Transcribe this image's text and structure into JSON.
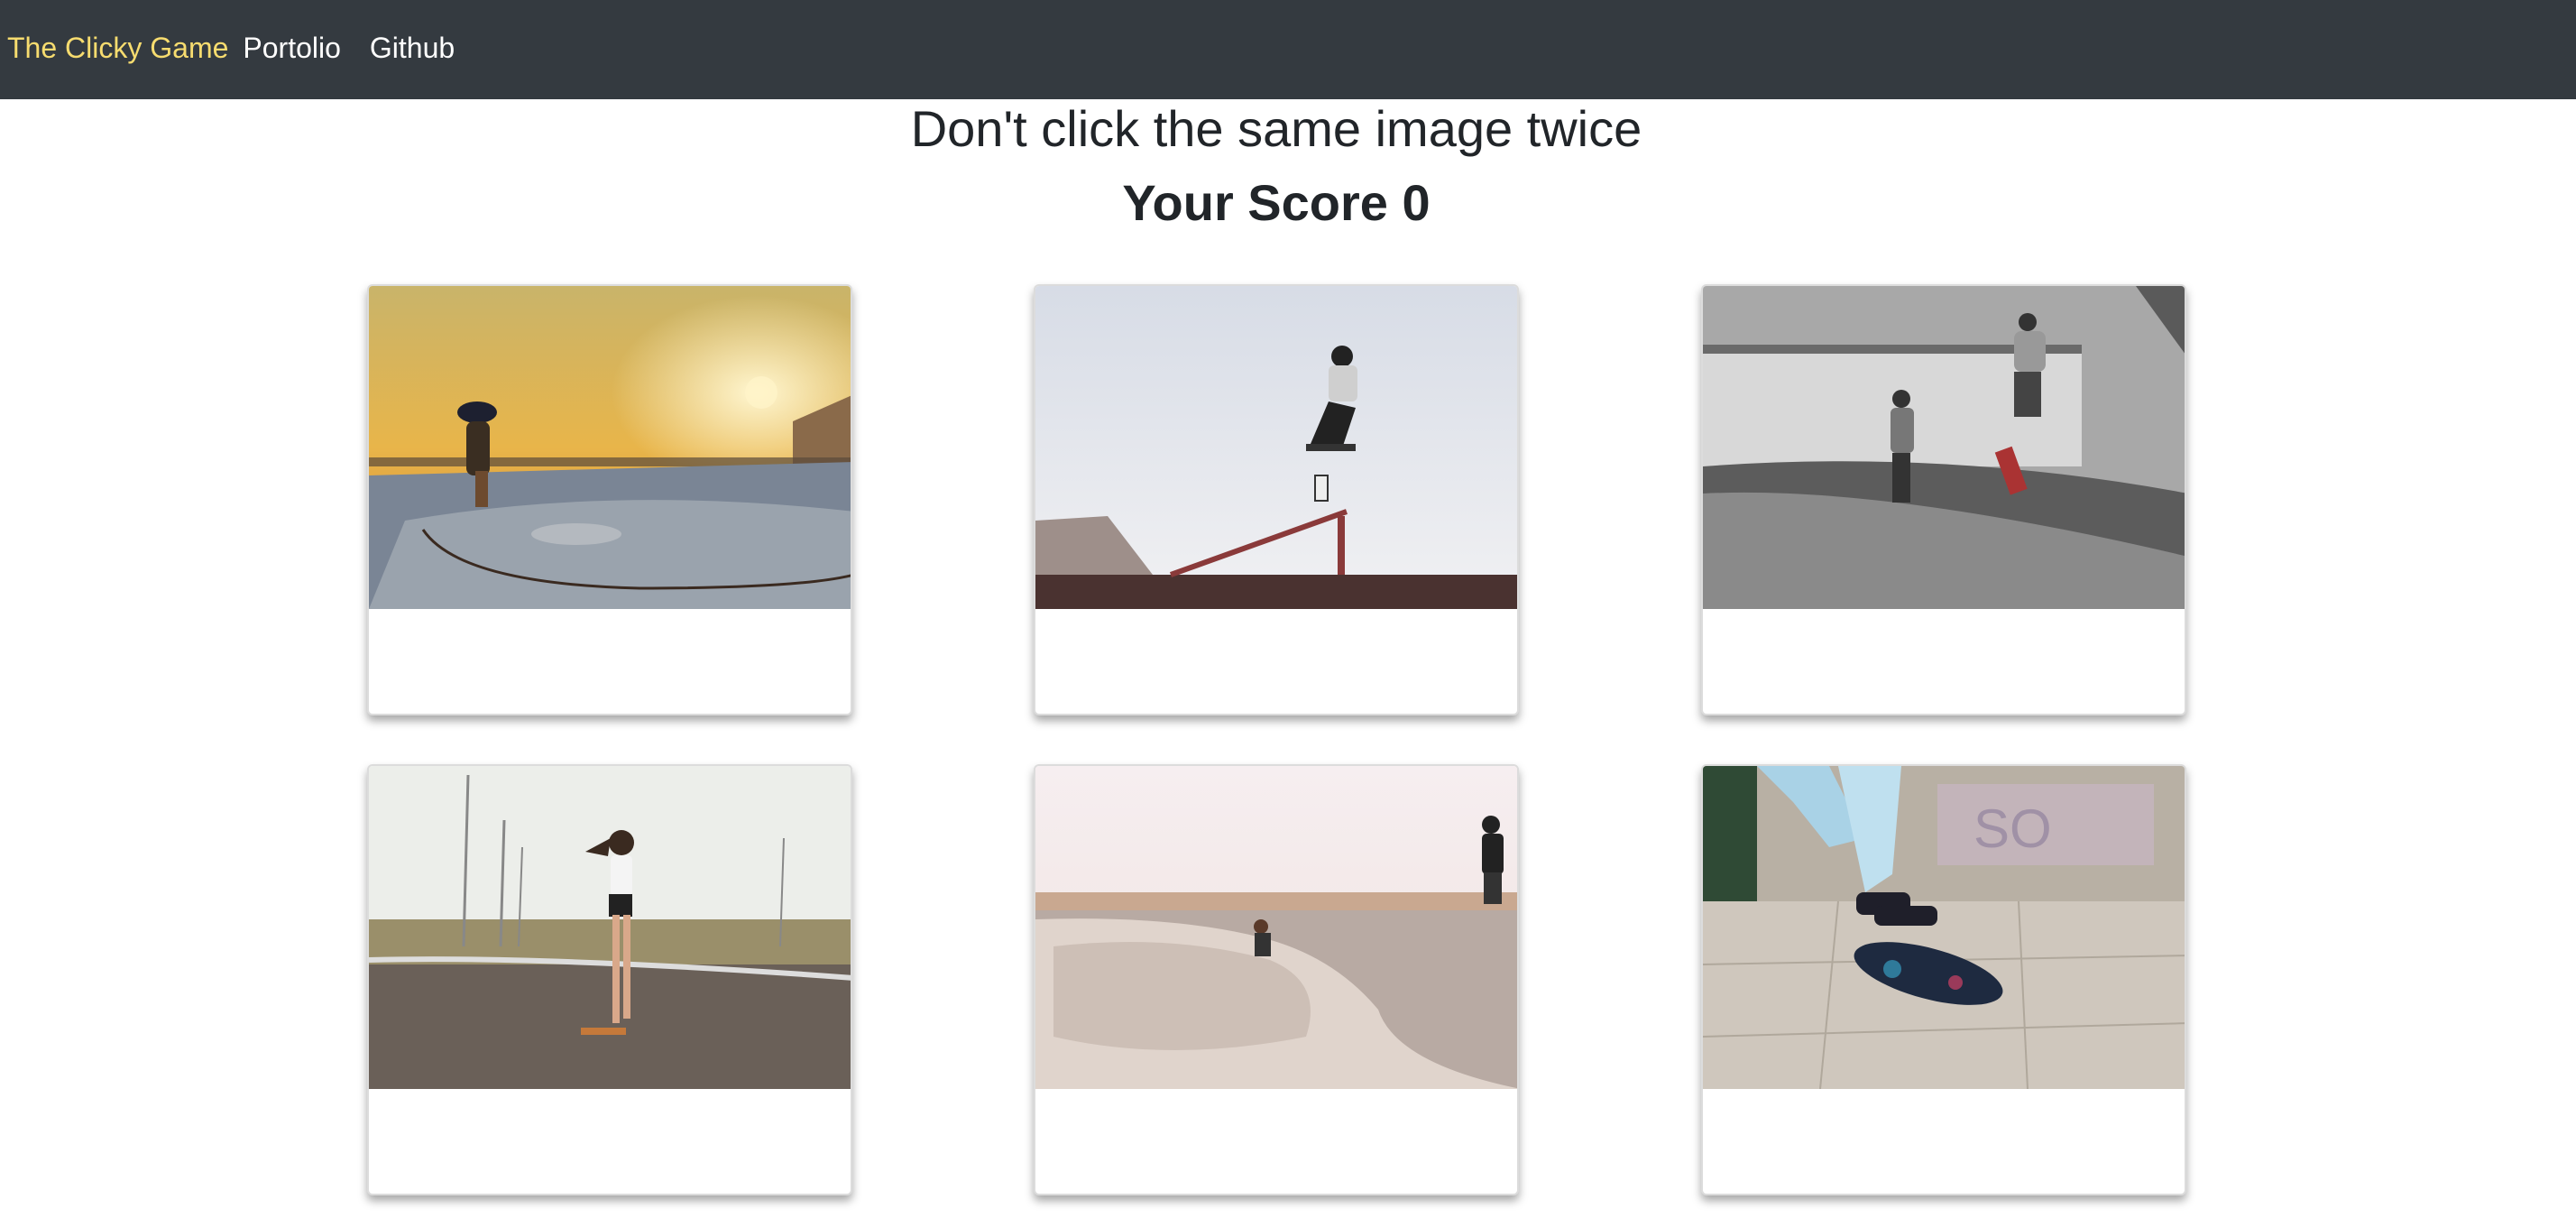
{
  "navbar": {
    "brand": "The Clicky Game",
    "links": [
      "Portolio",
      "Github"
    ]
  },
  "main": {
    "instruction": "Don't click the same image twice",
    "score_label": "Your Score 0"
  },
  "cards": [
    {
      "icon": "skateboarder-sunset-bowl-image"
    },
    {
      "icon": "skateboarder-rail-jump-image"
    },
    {
      "icon": "skatepark-ramp-image"
    },
    {
      "icon": "girl-longboard-road-image"
    },
    {
      "icon": "skatepark-bowl-image"
    },
    {
      "icon": "skateboard-kickflip-image"
    }
  ],
  "colors": {
    "navbar_bg": "#343a40",
    "brand": "#f7dc6f",
    "nav_link": "#ffffff",
    "text": "#212529"
  }
}
